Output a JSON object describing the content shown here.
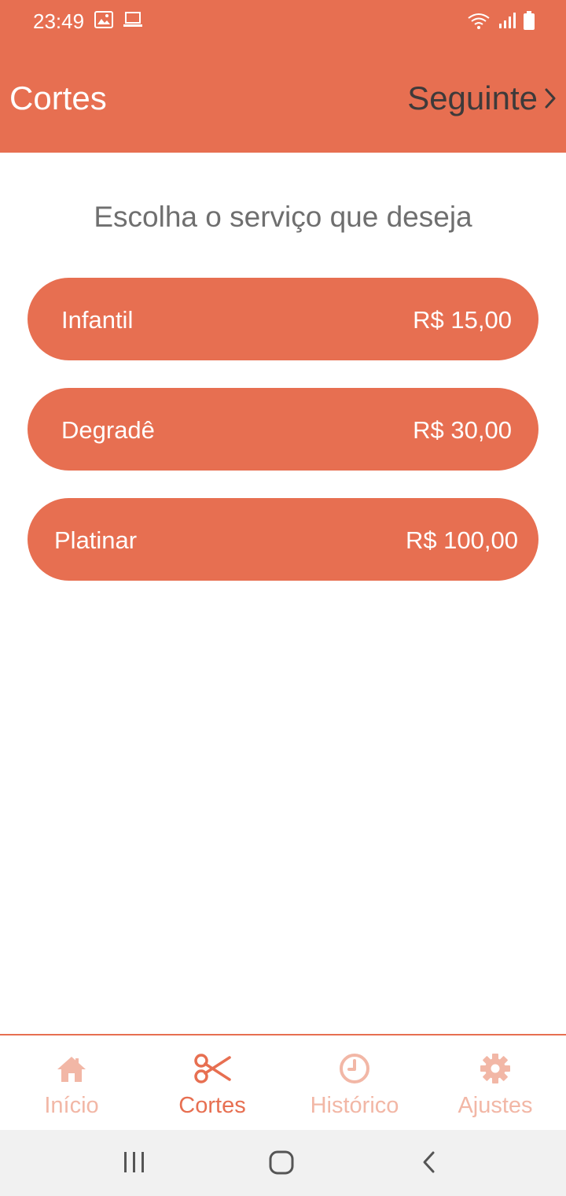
{
  "status_bar": {
    "time": "23:49",
    "left_icons": [
      "image-icon",
      "laptop-icon"
    ],
    "right_icons": [
      "wifi-icon",
      "signal-icon",
      "battery-icon"
    ]
  },
  "header": {
    "title": "Cortes",
    "next_label": "Seguinte"
  },
  "subtitle": "Escolha o serviço que deseja",
  "services": [
    {
      "name": "Infantil",
      "price": "R$ 15,00"
    },
    {
      "name": "Degradê",
      "price": "R$ 30,00"
    },
    {
      "name": "Platinar",
      "price": "R$ 100,00"
    }
  ],
  "bottom_nav": {
    "items": [
      {
        "label": "Início",
        "icon": "home-icon",
        "active": false
      },
      {
        "label": "Cortes",
        "icon": "scissors-icon",
        "active": true
      },
      {
        "label": "Histórico",
        "icon": "clock-icon",
        "active": false
      },
      {
        "label": "Ajustes",
        "icon": "gear-icon",
        "active": false
      }
    ]
  },
  "colors": {
    "accent": "#E76F51",
    "accent_light": "#F2B7A6",
    "header_next_text": "#3E3A3A",
    "subtitle_text": "#6F6F6F",
    "system_nav_bg": "#F1F1F1"
  }
}
